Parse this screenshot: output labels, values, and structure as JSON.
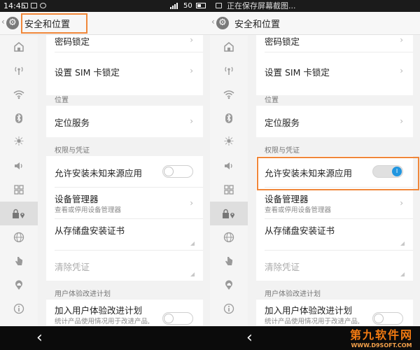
{
  "left": {
    "status": {
      "time": "14:45",
      "battery": "50",
      "icons": [
        "image-icon",
        "image-icon",
        "weibo-icon",
        "signal-icon",
        "battery-icon"
      ]
    },
    "header": {
      "title": "安全和位置"
    },
    "sidebar": [
      {
        "icon": "home-icon"
      },
      {
        "icon": "radio-icon"
      },
      {
        "icon": "wifi-icon"
      },
      {
        "icon": "bluetooth-icon"
      },
      {
        "icon": "brightness-icon"
      },
      {
        "icon": "volume-icon"
      },
      {
        "icon": "apps-grid-icon"
      },
      {
        "icon": "lock-location-icon",
        "active": true
      },
      {
        "icon": "globe-icon"
      },
      {
        "icon": "hand-icon"
      },
      {
        "icon": "cloud-location-icon"
      },
      {
        "icon": "info-icon"
      }
    ],
    "rows": {
      "password_lock": "密码锁定",
      "sim_lock": "设置 SIM 卡锁定",
      "section_location": "位置",
      "location_service": "定位服务",
      "section_permissions": "权限与凭证",
      "unknown_sources": "允许安装未知来源应用",
      "unknown_sources_enabled": false,
      "device_admin": "设备管理器",
      "device_admin_sub": "查看或停用设备管理器",
      "install_cert": "从存储盘安装证书",
      "clear_creds": "清除凭证",
      "section_ux": "用户体验改进计划",
      "join_ux": "加入用户体验改进计划",
      "join_ux_sub": "统计产品使用情况用于改进产品,",
      "join_ux_enabled": false
    }
  },
  "right": {
    "status": {
      "saving": "正在保存屏幕截图...",
      "icons": [
        "image-icon"
      ]
    },
    "header": {
      "title": "安全和位置"
    },
    "sidebar": [
      {
        "icon": "home-icon"
      },
      {
        "icon": "radio-icon"
      },
      {
        "icon": "wifi-icon"
      },
      {
        "icon": "bluetooth-icon"
      },
      {
        "icon": "brightness-icon"
      },
      {
        "icon": "volume-icon"
      },
      {
        "icon": "apps-grid-icon"
      },
      {
        "icon": "lock-location-icon",
        "active": true
      },
      {
        "icon": "globe-icon"
      },
      {
        "icon": "hand-icon"
      },
      {
        "icon": "cloud-location-icon"
      },
      {
        "icon": "info-icon"
      }
    ],
    "rows": {
      "password_lock": "密码锁定",
      "sim_lock": "设置 SIM 卡锁定",
      "section_location": "位置",
      "location_service": "定位服务",
      "section_permissions": "权限与凭证",
      "unknown_sources": "允许安装未知来源应用",
      "unknown_sources_enabled": true,
      "device_admin": "设备管理器",
      "device_admin_sub": "查看或停用设备管理器",
      "install_cert": "从存储盘安装证书",
      "clear_creds": "清除凭证",
      "section_ux": "用户体验改进计划",
      "join_ux": "加入用户体验改进计划",
      "join_ux_sub": "统计产品使用情况用于改进产品,",
      "join_ux_enabled": false
    }
  },
  "watermark": {
    "brand": "第九软件网",
    "url": "WWW.D9SOFT.COM"
  },
  "colors": {
    "highlight": "#f0873a",
    "toggle_on": "#2196e0",
    "watermark": "#f27a12"
  }
}
